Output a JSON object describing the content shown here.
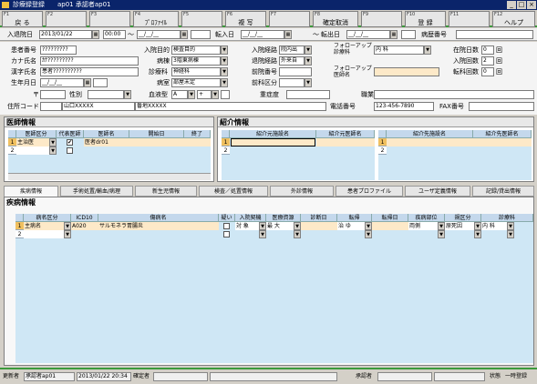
{
  "window": {
    "title": "診療録登録　　ap01 承認者ap01"
  },
  "fkeys": [
    {
      "num": "F1",
      "label": "戻 る"
    },
    {
      "num": "F2",
      "label": ""
    },
    {
      "num": "F3",
      "label": ""
    },
    {
      "num": "F4",
      "label": "ﾌﾟﾛﾌｧｲﾙ"
    },
    {
      "num": "F5",
      "label": ""
    },
    {
      "num": "F6",
      "label": "複 写"
    },
    {
      "num": "F7",
      "label": ""
    },
    {
      "num": "F8",
      "label": "確定取消"
    },
    {
      "num": "F9",
      "label": ""
    },
    {
      "num": "F10",
      "label": "登 録"
    },
    {
      "num": "F11",
      "label": ""
    },
    {
      "num": "F12",
      "label": "ヘルプ"
    }
  ],
  "top": {
    "admit_label": "入退院日",
    "admit_date": "2013/01/22",
    "admit_time": "00:00",
    "tilde": "～",
    "date_blank": "__/__/__",
    "transfer_in_label": "転入日",
    "transfer_out_label": "転出日",
    "tilde2": "～",
    "record_no_label": "病歴番号"
  },
  "form": {
    "patient_no_label": "患者番号",
    "patient_no": "?????????",
    "kana_label": "カナ氏名",
    "kana": "ｶﾅ?????????",
    "kanji_label": "漢字氏名",
    "kanji": "患者??????????",
    "birth_label": "生年月日",
    "birth": "__/__/__",
    "zip_label": "〒",
    "gender_label": "性別",
    "address_label": "住所コード",
    "address1": "山口XXXXX",
    "address2": "番地XXXXX",
    "purpose_label": "入院目的",
    "purpose": "検査目的",
    "ward_label": "病棟",
    "ward": "3階東病棟",
    "dept_label": "診療科",
    "dept": "神経科",
    "room_label": "病室",
    "room": "部屋未定",
    "blood_label": "血液型",
    "blood": "A",
    "rh": "+",
    "route_in_label": "入院経路",
    "route_in": "院内出",
    "route_out_label": "退院経路",
    "route_out": "外来自",
    "pre_dept_label": "前院番号",
    "post_dept_label": "前科区分",
    "other_label": "重症度",
    "followup_label": "フォローアップ診療科",
    "followup": "内 科",
    "followup_doc_label": "フォローアップ医師名",
    "stay_days_label": "在院日数",
    "stay_days": "0",
    "admit_count_label": "入院回数",
    "admit_count": "2",
    "transfer_count_label": "転科回数",
    "transfer_count": "0",
    "unit_label": "回",
    "job_label": "職業",
    "phone_label": "電話番号",
    "phone": "123-456-7890",
    "fax_label": "FAX番号"
  },
  "doctor": {
    "title": "医師情報",
    "headers": [
      "医師区分",
      "代表医師",
      "医師名",
      "開始日",
      "終了"
    ],
    "rows": [
      {
        "no": "1",
        "kind": "主治医",
        "rep": "✔",
        "name": "医者dr01",
        "start": ""
      },
      {
        "no": "2",
        "kind": "",
        "rep": "",
        "name": "",
        "start": ""
      }
    ]
  },
  "referral": {
    "title": "紹介情報",
    "left_headers": [
      "紹介元施設名",
      "紹介元医師名"
    ],
    "right_headers": [
      "紹介先施設名",
      "紹介先医師名"
    ],
    "rows": [
      "1",
      "2"
    ]
  },
  "tabs": [
    "疾病情報",
    "手術処置/輸血/病理",
    "新生児情報",
    "検査／処置情報",
    "外診情報",
    "患者プロファイル",
    "ユーザ定義情報",
    "記録/貸出情報"
  ],
  "disease": {
    "title": "疾病情報",
    "headers": [
      "病名区分",
      "ICD10",
      "傷病名",
      "疑い",
      "入院契機",
      "医療資源",
      "診断日",
      "転帰",
      "転帰日",
      "疾病部位",
      "規区分",
      "診療科"
    ],
    "row": {
      "no": "1",
      "kind": "主病名",
      "icd": "A020",
      "name": "サルモネラ胃腸炎",
      "trigger": "対 象",
      "resource": "最 大",
      "outcome": "治 ゆ",
      "site": "両側",
      "category": "原死因",
      "dept": "内 科"
    },
    "row2": "2"
  },
  "status": {
    "updater_label": "更新者",
    "updater": "承認者ap01",
    "updated_at": "2013/01/22 20:34",
    "confirm_label": "確定者",
    "approver_label": "承認者",
    "state_label": "状態",
    "state": "一時登録"
  }
}
